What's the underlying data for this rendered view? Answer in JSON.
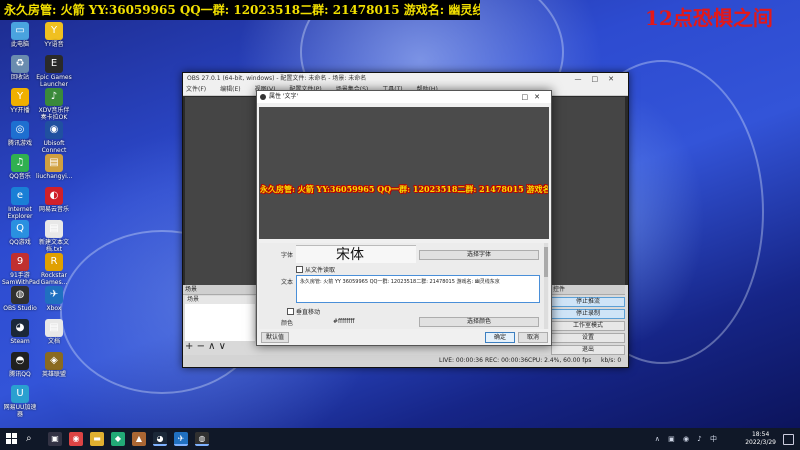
{
  "overlay_title": "永久房管: 火箭 YY:36059965 QQ一群: 12023518二群: 21478015 游戏名: 幽灵线东京",
  "watermark": "12点恐惧之间",
  "desktop_icons": [
    {
      "label": "此电脑",
      "icon": "pc-icon",
      "glyph": "▭",
      "color": "#4aa3df"
    },
    {
      "label": "YY语音",
      "icon": "yy-icon",
      "glyph": "Y",
      "color": "#f0c020"
    },
    {
      "label": "回收站",
      "icon": "recycle-bin-icon",
      "glyph": "♻",
      "color": "#6a8caf"
    },
    {
      "label": "Epic Games Launcher",
      "icon": "epic-icon",
      "glyph": "E",
      "color": "#2a2a2a"
    },
    {
      "label": "YY开播",
      "icon": "yy-live-icon",
      "glyph": "Y",
      "color": "#f0b000"
    },
    {
      "label": "XDV音乐伴奏卡拉OK",
      "icon": "music-icon",
      "glyph": "♪",
      "color": "#3a8a3a"
    },
    {
      "label": "腾讯游戏",
      "icon": "tencent-games-icon",
      "glyph": "◎",
      "color": "#1e6fd0"
    },
    {
      "label": "Ubisoft Connect",
      "icon": "ubisoft-icon",
      "glyph": "◉",
      "color": "#2050a0"
    },
    {
      "label": "QQ音乐",
      "icon": "qq-music-icon",
      "glyph": "♫",
      "color": "#30b050"
    },
    {
      "label": "liuchangyi...",
      "icon": "file-icon",
      "glyph": "▤",
      "color": "#d0a040"
    },
    {
      "label": "Internet Explorer",
      "icon": "ie-icon",
      "glyph": "e",
      "color": "#1a7fd6"
    },
    {
      "label": "网易云音乐",
      "icon": "netease-music-icon",
      "glyph": "◐",
      "color": "#d0202a"
    },
    {
      "label": "QQ游戏",
      "icon": "qq-games-icon",
      "glyph": "Q",
      "color": "#2a90e0"
    },
    {
      "label": "新建文本文档.txt",
      "icon": "text-file-icon",
      "glyph": "▤",
      "color": "#e8e8e8"
    },
    {
      "label": "91手游 SamWithPad",
      "icon": "game-icon",
      "glyph": "9",
      "color": "#c03030"
    },
    {
      "label": "Rockstar Games...",
      "icon": "rockstar-icon",
      "glyph": "R",
      "color": "#e0a000"
    },
    {
      "label": "OBS Studio",
      "icon": "obs-icon",
      "glyph": "◍",
      "color": "#303030"
    },
    {
      "label": "Xbox",
      "icon": "xbox-icon",
      "glyph": "✈",
      "color": "#2070c0"
    },
    {
      "label": "Steam",
      "icon": "steam-icon",
      "glyph": "◕",
      "color": "#1b2838"
    },
    {
      "label": "文档",
      "icon": "document-icon",
      "glyph": "▤",
      "color": "#e8e8e8"
    },
    {
      "label": "腾讯QQ",
      "icon": "qq-icon",
      "glyph": "◓",
      "color": "#202020"
    },
    {
      "label": "英雄联盟",
      "icon": "lol-icon",
      "glyph": "◈",
      "color": "#8a6a20"
    },
    {
      "label": "网易UU加速器",
      "icon": "uu-icon",
      "glyph": "U",
      "color": "#2aa0d0"
    }
  ],
  "obs": {
    "title": "OBS 27.0.1 (64-bit, windows) - 配置文件: 未命名 - 场景: 未命名",
    "menu": [
      "文件(F)",
      "编辑(E)",
      "视图(V)",
      "配置文件(P)",
      "场景集合(S)",
      "工具(T)",
      "帮助(H)"
    ],
    "scenes_header": "场景",
    "scene_item": "场景",
    "controls_header": "控件",
    "controls": [
      "停止推流",
      "停止录制",
      "工作室模式",
      "设置",
      "退出"
    ],
    "status": {
      "live": "LIVE: 00:00:36",
      "rec": "REC: 00:00:36",
      "cpu": "CPU: 2.4%, 60.00 fps",
      "kbps": "kb/s: 0"
    }
  },
  "dialog": {
    "title": "属性 '文字'",
    "preview_text": "永久房管: 火箭 YY:36059965 QQ一群: 12023518二群: 21478015 游戏名: 幽灵线东京",
    "font_label": "字体",
    "font_value": "宋体",
    "select_font": "选择字体",
    "from_file": "从文件读取",
    "text_label": "文本",
    "text_value": "永久房管: 火箭 YY 36059965 QQ一群: 12023518二群: 21478015 游戏名: 幽灵线东京",
    "vertical": "垂直移动",
    "color_label": "颜色",
    "color_value": "#ffffffff",
    "select_color": "选择颜色",
    "defaults": "默认值",
    "ok": "确定",
    "cancel": "取消"
  },
  "taskbar": {
    "time": "18:54",
    "date": "2022/3/29",
    "apps": [
      {
        "name": "task-view-icon",
        "glyph": "▣",
        "color": "#334"
      },
      {
        "name": "chrome-icon",
        "glyph": "◉",
        "color": "#d44"
      },
      {
        "name": "folder-icon",
        "glyph": "▬",
        "color": "#e0b030"
      },
      {
        "name": "game-launcher-icon",
        "glyph": "◆",
        "color": "#2a7"
      },
      {
        "name": "app-icon",
        "glyph": "▲",
        "color": "#a63"
      },
      {
        "name": "steam-taskbar-icon",
        "glyph": "◕",
        "color": "#1b2838"
      },
      {
        "name": "xbox-taskbar-icon",
        "glyph": "✈",
        "color": "#2070c0"
      },
      {
        "name": "obs-taskbar-icon",
        "glyph": "◍",
        "color": "#303030"
      }
    ]
  }
}
